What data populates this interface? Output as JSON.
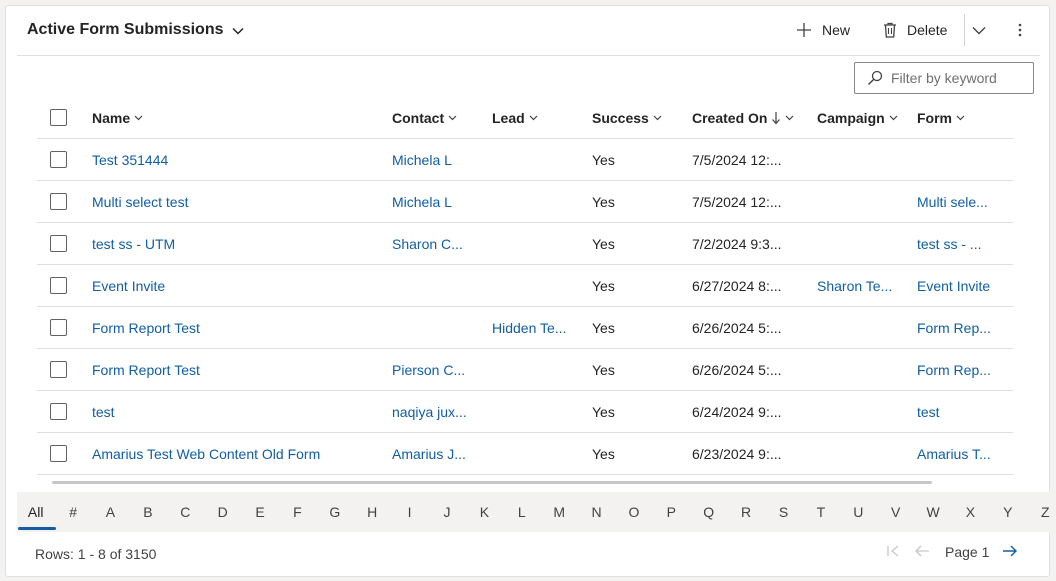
{
  "view": {
    "title": "Active Form Submissions"
  },
  "commands": {
    "new_label": "New",
    "delete_label": "Delete"
  },
  "filter": {
    "placeholder": "Filter by keyword"
  },
  "columns": {
    "name": "Name",
    "contact": "Contact",
    "lead": "Lead",
    "success": "Success",
    "created_on": "Created On",
    "campaign": "Campaign",
    "form": "Form"
  },
  "rows": [
    {
      "name": "Test 351444",
      "contact": "Michela L",
      "lead": "",
      "success": "Yes",
      "created_on": "7/5/2024 12:...",
      "campaign": "",
      "form": ""
    },
    {
      "name": "Multi select test",
      "contact": "Michela L",
      "lead": "",
      "success": "Yes",
      "created_on": "7/5/2024 12:...",
      "campaign": "",
      "form": "Multi sele..."
    },
    {
      "name": "test ss - UTM",
      "contact": "Sharon C...",
      "lead": "",
      "success": "Yes",
      "created_on": "7/2/2024 9:3...",
      "campaign": "",
      "form": "test ss - ..."
    },
    {
      "name": "Event Invite",
      "contact": "",
      "lead": "",
      "success": "Yes",
      "created_on": "6/27/2024 8:...",
      "campaign": "Sharon Te...",
      "form": "Event Invite"
    },
    {
      "name": "Form Report Test",
      "contact": "",
      "lead": "Hidden Te...",
      "success": "Yes",
      "created_on": "6/26/2024 5:...",
      "campaign": "",
      "form": "Form Rep..."
    },
    {
      "name": "Form Report Test",
      "contact": "Pierson C...",
      "lead": "",
      "success": "Yes",
      "created_on": "6/26/2024 5:...",
      "campaign": "",
      "form": "Form Rep..."
    },
    {
      "name": "test",
      "contact": "naqiya jux...",
      "lead": "",
      "success": "Yes",
      "created_on": "6/24/2024 9:...",
      "campaign": "",
      "form": "test"
    },
    {
      "name": "Amarius Test Web Content Old Form",
      "contact": "Amarius J...",
      "lead": "",
      "success": "Yes",
      "created_on": "6/23/2024 9:...",
      "campaign": "",
      "form": "Amarius T..."
    }
  ],
  "alphabet": [
    "All",
    "#",
    "A",
    "B",
    "C",
    "D",
    "E",
    "F",
    "G",
    "H",
    "I",
    "J",
    "K",
    "L",
    "M",
    "N",
    "O",
    "P",
    "Q",
    "R",
    "S",
    "T",
    "U",
    "V",
    "W",
    "X",
    "Y",
    "Z"
  ],
  "alphabet_selected": "All",
  "footer": {
    "rows_label": "Rows: 1 - 8 of 3150",
    "page_label": "Page 1"
  },
  "colors": {
    "link": "#115ea3",
    "accent": "#115ea3",
    "border": "#e1dfdd"
  }
}
